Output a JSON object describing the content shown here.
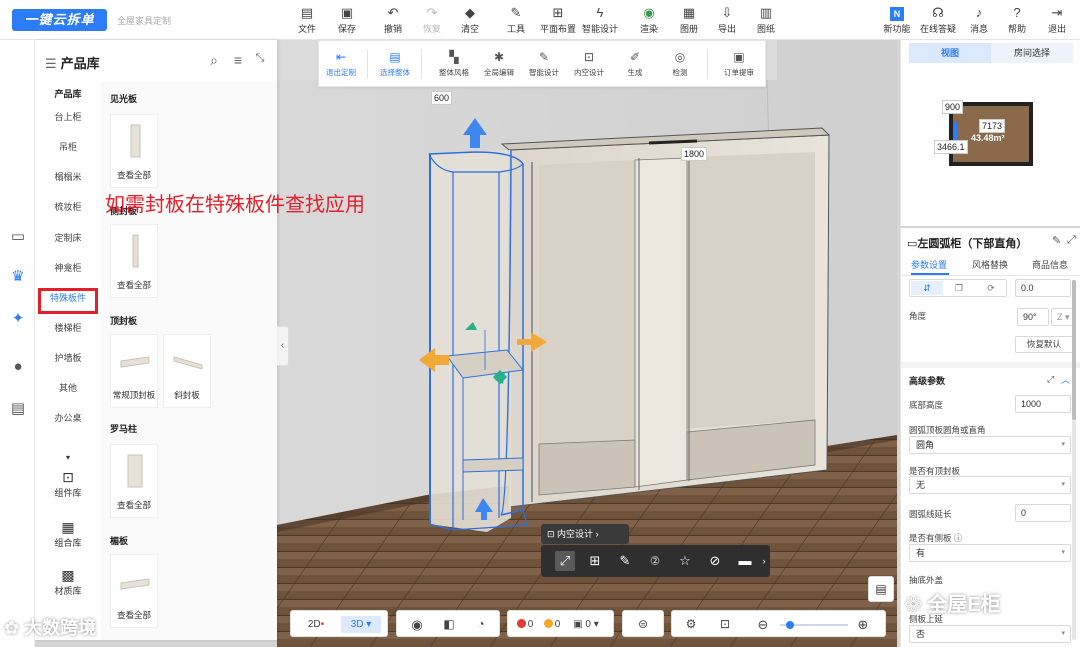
{
  "app": {
    "logo_text": "一键云拆单",
    "sub_text": "全屋家具定制"
  },
  "toolbar": {
    "items": [
      {
        "label": "文件",
        "icon": "file-icon"
      },
      {
        "label": "保存",
        "icon": "save-icon"
      },
      {
        "label": "撤销",
        "icon": "undo-icon"
      },
      {
        "label": "恢复",
        "icon": "redo-icon"
      },
      {
        "label": "清空",
        "icon": "eraser-icon"
      },
      {
        "label": "工具",
        "icon": "wrench-icon"
      },
      {
        "label": "平面布置",
        "icon": "grid-icon"
      },
      {
        "label": "智能设计",
        "icon": "lightning-icon"
      },
      {
        "label": "渲染",
        "icon": "render-icon"
      },
      {
        "label": "图册",
        "icon": "album-icon"
      },
      {
        "label": "导出",
        "icon": "export-icon"
      },
      {
        "label": "图纸",
        "icon": "drawing-icon"
      }
    ],
    "right": [
      {
        "label": "新功能",
        "icon": "new-feature-icon"
      },
      {
        "label": "在线答疑",
        "icon": "headset-icon"
      },
      {
        "label": "消息",
        "icon": "bell-icon"
      },
      {
        "label": "帮助",
        "icon": "help-icon"
      },
      {
        "label": "退出",
        "icon": "logout-icon"
      }
    ]
  },
  "rail": {
    "icons": [
      "sofa-icon",
      "crown-icon",
      "model-icon",
      "user-icon",
      "cabinet-icon"
    ]
  },
  "library": {
    "title": "产品库",
    "categories": [
      "产品库",
      "台上柜",
      "吊柜",
      "榻榻米",
      "梳妆柜",
      "定制床",
      "神龛柜",
      "特殊板件",
      "楼梯柜",
      "护墙板",
      "其他",
      "办公桌"
    ],
    "selected_category": "特殊板件",
    "bottom": [
      {
        "label": "组件库",
        "icon": "component-icon"
      },
      {
        "label": "组合库",
        "icon": "combo-icon"
      },
      {
        "label": "材质库",
        "icon": "material-icon"
      }
    ],
    "sections": [
      {
        "title": "见光板",
        "cards": [
          "查看全部"
        ]
      },
      {
        "title": "侧封板",
        "cards": [
          "查看全部"
        ]
      },
      {
        "title": "顶封板",
        "cards": [
          "常规顶封板",
          "斜封板"
        ]
      },
      {
        "title": "罗马柱",
        "cards": [
          "查看全部"
        ]
      },
      {
        "title": "楣板",
        "cards": [
          "查看全部"
        ]
      }
    ]
  },
  "annotation": "如需封板在特殊板件查找应用",
  "context_toolbar": {
    "items": [
      {
        "label": "退出定制",
        "icon": "exit-custom-icon",
        "active": true
      },
      {
        "label": "选择整体",
        "icon": "select-all-icon",
        "active": true
      },
      {
        "label": "整体风格",
        "icon": "style-icon"
      },
      {
        "label": "全局编辑",
        "icon": "global-edit-icon"
      },
      {
        "label": "智能设计",
        "icon": "smart-design-icon"
      },
      {
        "label": "内空设计",
        "icon": "interior-design-icon"
      },
      {
        "label": "生成",
        "icon": "generate-icon"
      },
      {
        "label": "检测",
        "icon": "detect-icon"
      },
      {
        "label": "订单提审",
        "icon": "order-icon"
      }
    ]
  },
  "dimensions": {
    "width_left": "600",
    "width_total": "1800"
  },
  "selection": {
    "pill_label": "内空设计",
    "tools": [
      "resize-icon",
      "add-icon",
      "brush-icon",
      "view-2d-icon",
      "star-icon",
      "hide-icon",
      "delete-icon"
    ]
  },
  "bottom_bar": {
    "view_2d": "2D",
    "view_3d": "3D",
    "status_counts": {
      "errors": "0",
      "warnings": "0",
      "items": "0"
    },
    "status_colors": {
      "error": "#e53935",
      "warning": "#f5a623"
    }
  },
  "minimap": {
    "tabs": [
      "视图",
      "房间选择"
    ],
    "active_tab": "视图",
    "labels": [
      "900",
      "7173",
      "43.48m²",
      "3466.1"
    ]
  },
  "properties": {
    "title": "左圆弧柜（下部直角）",
    "tabs": [
      "参数设置",
      "风格替换",
      "商品信息"
    ],
    "active_tab": "参数设置",
    "offset_value": "0.0",
    "angle_label": "角度",
    "angle_value": "90°",
    "angle_axis": "Z",
    "reset_label": "恢复默认",
    "advanced_title": "高级参数",
    "fields": [
      {
        "label": "底部高度",
        "value": "1000"
      },
      {
        "label": "圆弧顶板圆角或直角",
        "value": "圆角"
      },
      {
        "label": "是否有顶封板",
        "value": "无"
      },
      {
        "label": "圆弧线延长",
        "value": "0"
      },
      {
        "label": "是否有侧板",
        "value": "有"
      },
      {
        "label": "抽底外盖",
        "value": ""
      },
      {
        "label": "侧板上延",
        "value": "否"
      }
    ]
  },
  "watermarks": {
    "left": "大数跨境",
    "right": "全屋E柜"
  },
  "colors": {
    "accent": "#2b7cf5",
    "highlight": "#e3202a"
  }
}
